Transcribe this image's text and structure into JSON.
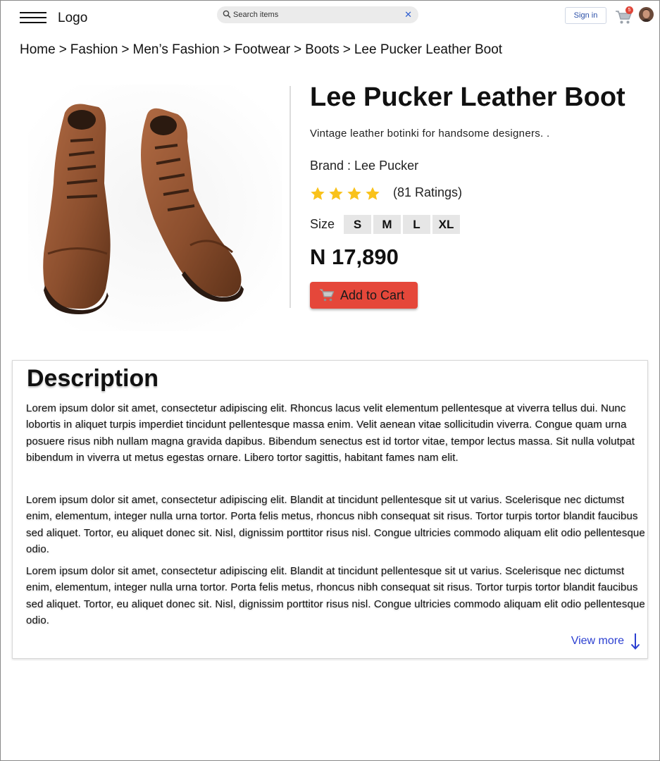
{
  "header": {
    "logo": "Logo",
    "search": {
      "placeholder": "Search items",
      "value": ""
    },
    "signin_label": "Sign in",
    "cart_count": "5"
  },
  "breadcrumb": [
    "Home",
    "Fashion",
    "Men’s Fashion",
    "Footwear",
    "Boots",
    "Lee Pucker Leather Boot"
  ],
  "breadcrumb_separator": ">",
  "product": {
    "title": "Lee Pucker Leather Boot",
    "tagline": "Vintage leather botinki for handsome designers. .",
    "brand": "Brand : Lee Pucker",
    "rating_stars": 4,
    "ratings_text": "(81 Ratings)",
    "size_label": "Size",
    "sizes": [
      "S",
      "M",
      "L",
      "XL"
    ],
    "price": "N 17,890",
    "add_to_cart_label": "Add to Cart",
    "image_icon": "leather-boots-photo"
  },
  "description": {
    "title": "Description",
    "paragraphs": [
      "Lorem ipsum dolor sit amet, consectetur adipiscing elit. Rhoncus lacus velit elementum pellentesque at viverra tellus dui. Nunc lobortis in aliquet turpis imperdiet tincidunt pellentesque massa enim. Velit aenean vitae sollicitudin viverra. Congue quam urna posuere risus nibh nullam magna gravida dapibus. Bibendum senectus est id tortor vitae, tempor lectus massa. Sit nulla volutpat bibendum in viverra ut metus egestas ornare. Libero tortor sagittis, habitant fames nam elit.",
      "Lorem ipsum dolor sit amet, consectetur adipiscing elit. Blandit at tincidunt pellentesque sit ut varius. Scelerisque nec dictumst enim, elementum, integer nulla urna tortor. Porta felis metus, rhoncus nibh consequat sit risus. Tortor turpis tortor blandit faucibus sed aliquet. Tortor, eu aliquet donec sit. Nisl, dignissim porttitor risus nisl. Congue ultricies commodo aliquam elit odio pellentesque odio.",
      "Lorem ipsum dolor sit amet, consectetur adipiscing elit. Blandit at tincidunt pellentesque sit ut varius. Scelerisque nec dictumst enim, elementum, integer nulla urna tortor. Porta felis metus, rhoncus nibh consequat sit risus. Tortor turpis tortor blandit faucibus sed aliquet. Tortor, eu aliquet donec sit. Nisl, dignissim porttitor risus nisl. Congue ultricies commodo aliquam elit odio pellentesque odio."
    ],
    "view_more_label": "View more"
  },
  "colors": {
    "accent_button": "#e5473a",
    "link": "#2b3fd1",
    "star": "#f9c21b",
    "badge": "#e0463a"
  }
}
